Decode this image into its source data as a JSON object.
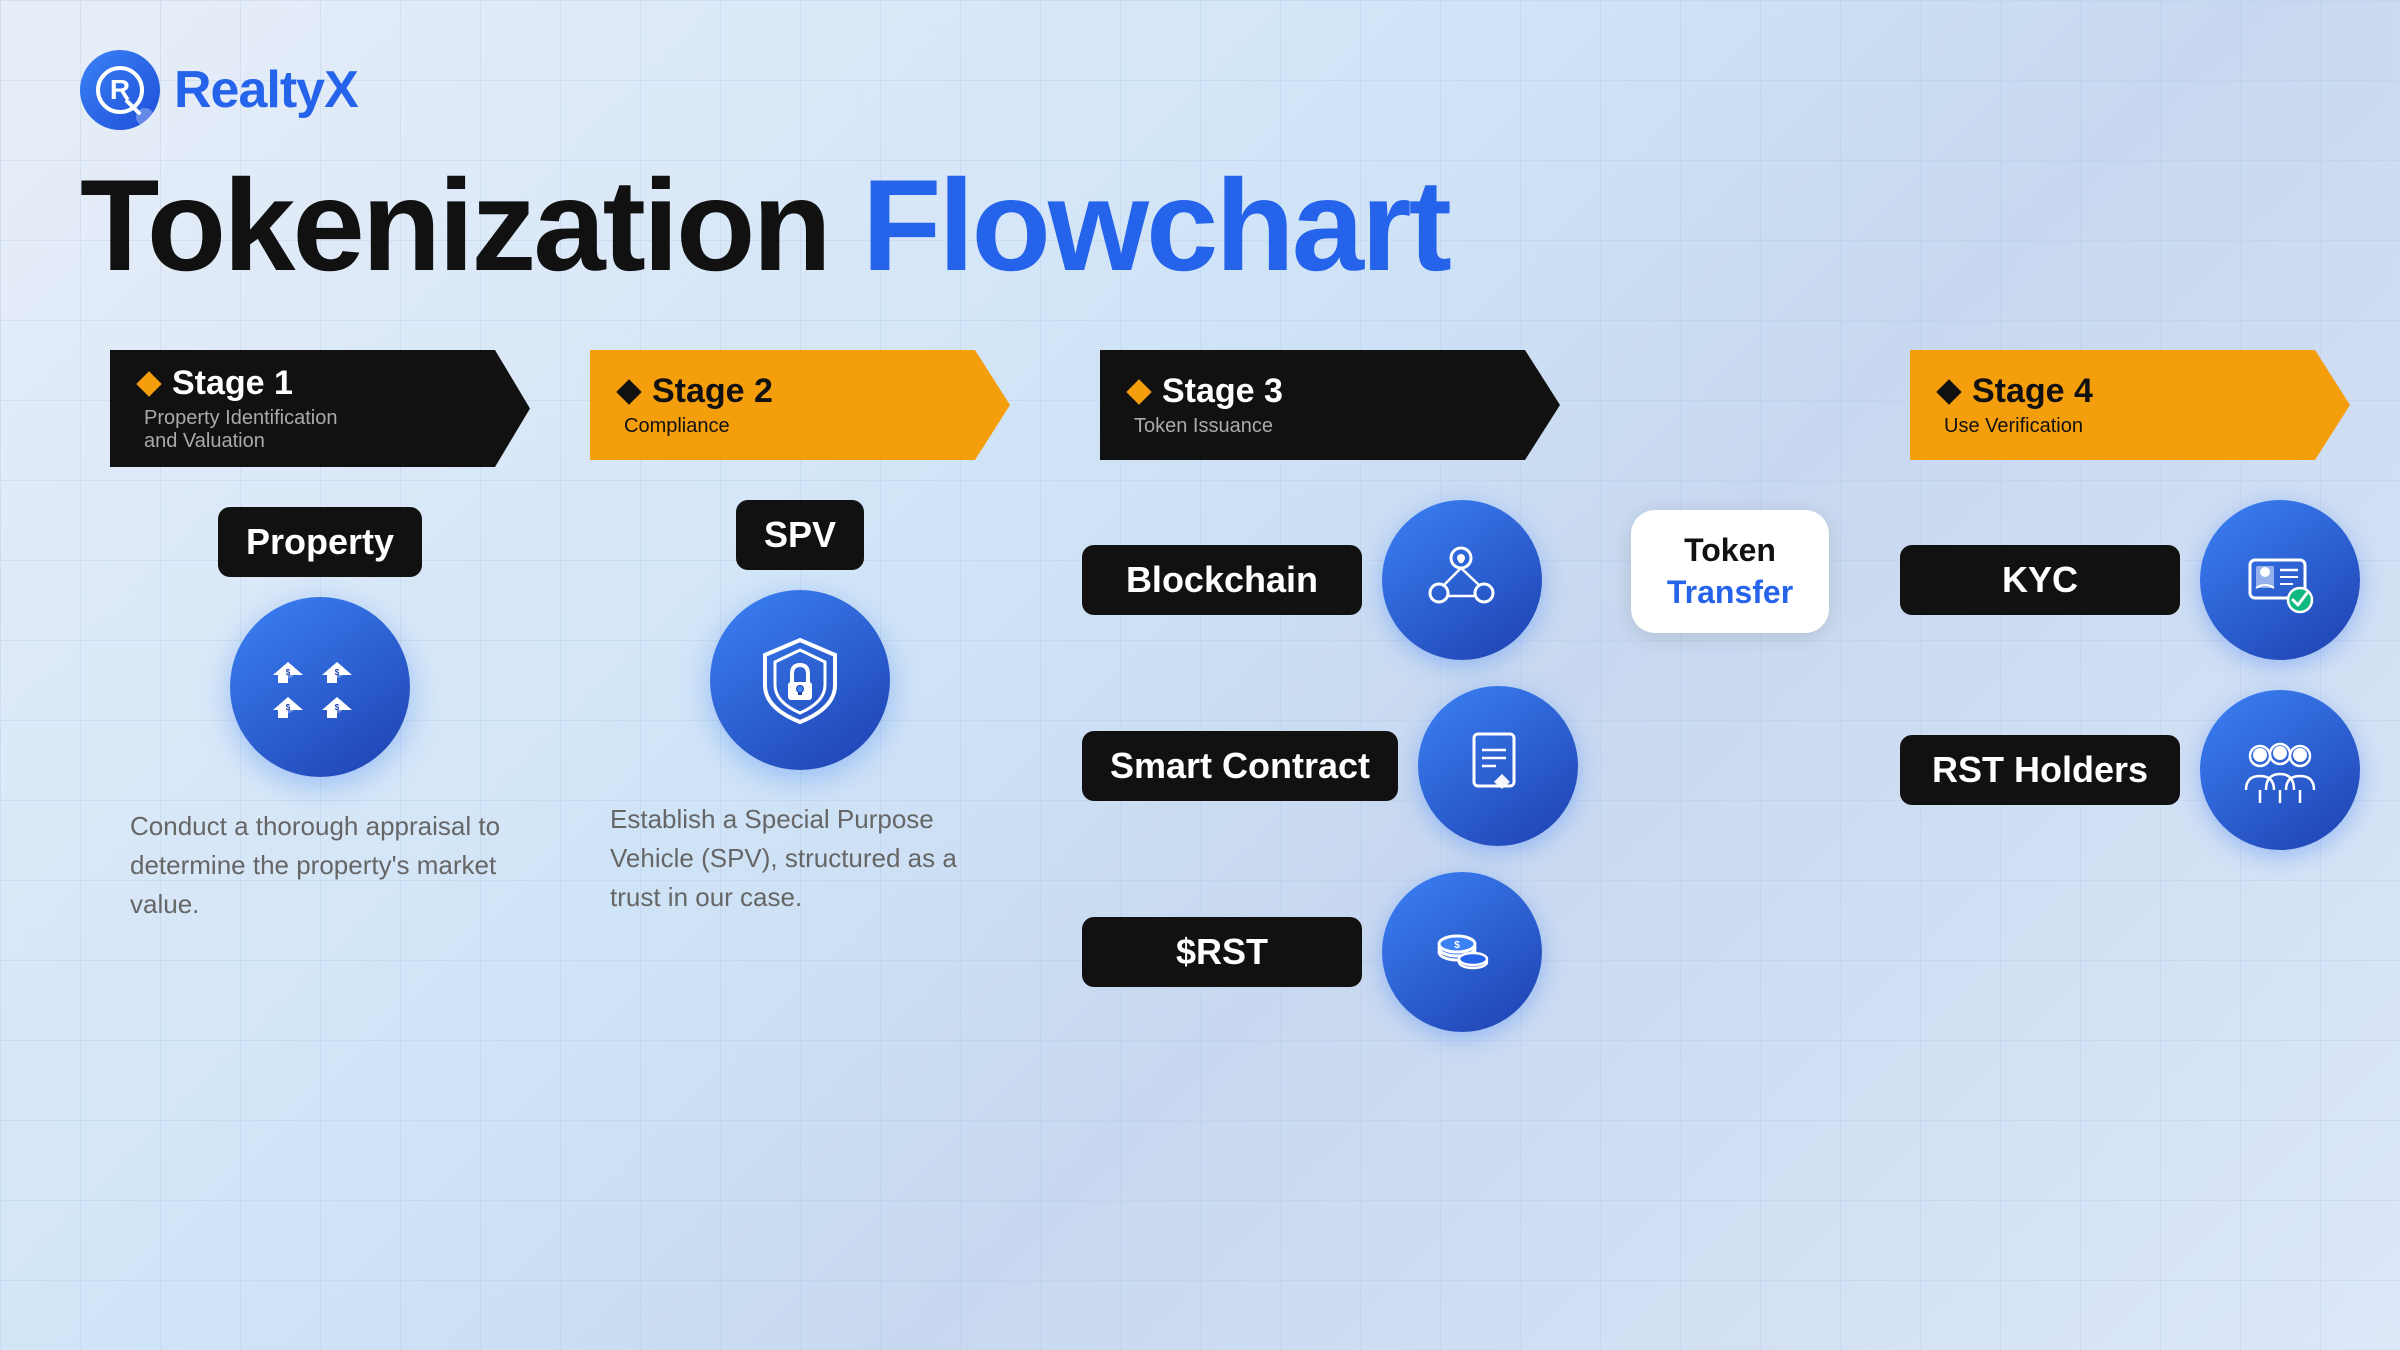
{
  "logo": {
    "letter": "R",
    "brand": "Realty",
    "brand_accent": "X"
  },
  "title": {
    "part1": "Tokenization ",
    "part2": "Flowchart"
  },
  "stages": [
    {
      "id": "stage1",
      "number": "Stage 1",
      "subtitle": "Property Identification\nand Valuation",
      "color": "dark",
      "items": [
        {
          "label": "Property",
          "icon": "property",
          "description": "Conduct a thorough appraisal to determine the property's market value."
        }
      ]
    },
    {
      "id": "stage2",
      "number": "Stage 2",
      "subtitle": "Compliance",
      "color": "gold",
      "items": [
        {
          "label": "SPV",
          "icon": "spv",
          "description": "Establish a Special Purpose Vehicle (SPV), structured as a trust in our case."
        }
      ]
    },
    {
      "id": "stage3",
      "number": "Stage 3",
      "subtitle": "Token Issuance",
      "color": "dark",
      "items": [
        {
          "label": "Blockchain",
          "icon": "blockchain"
        },
        {
          "label": "Smart Contract",
          "icon": "smart-contract"
        },
        {
          "label": "$RST",
          "icon": "rst"
        }
      ]
    },
    {
      "id": "stage4",
      "number": "Stage 4",
      "subtitle": "Use Verification",
      "color": "gold",
      "items": [
        {
          "label": "KYC",
          "icon": "kyc"
        },
        {
          "label": "RST Holders",
          "icon": "rst-holders"
        }
      ]
    }
  ],
  "token_transfer": {
    "line1": "Token",
    "line2": "Transfer"
  }
}
